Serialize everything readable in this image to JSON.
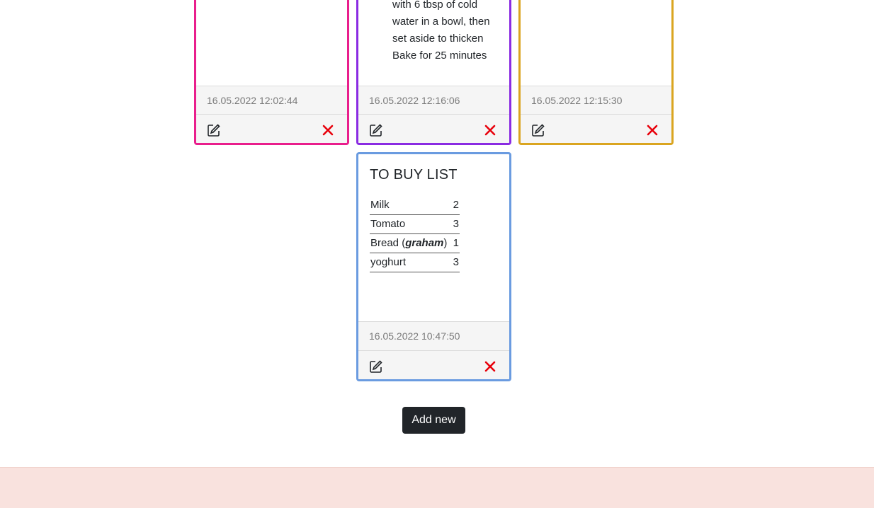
{
  "cards_top": [
    {
      "color": "#e91e8c",
      "date": "16.05.2022 12:02:44"
    },
    {
      "color": "#8a2be2",
      "date": "16.05.2022 12:16:06",
      "text_lines": [
        "with 6 tbsp of cold",
        "water in a bowl, then",
        "set aside to thicken",
        "Bake for 25 minutes"
      ]
    },
    {
      "color": "#daa520",
      "date": "16.05.2022 12:15:30"
    }
  ],
  "card_buy": {
    "color": "#6a9be0",
    "title": "TO BUY LIST",
    "items": [
      {
        "name": "Milk",
        "qty": "2"
      },
      {
        "name": "Tomato",
        "qty": "3"
      },
      {
        "name_prefix": "Bread (",
        "name_em": "graham",
        "name_suffix": ")",
        "qty": "1"
      },
      {
        "name": "yoghurt",
        "qty": "3"
      }
    ],
    "date": "16.05.2022 10:47:50"
  },
  "icons": {
    "edit": "edit-icon",
    "delete": "delete-x-icon",
    "delete_color": "#e8000b"
  },
  "add_button_label": "Add new"
}
